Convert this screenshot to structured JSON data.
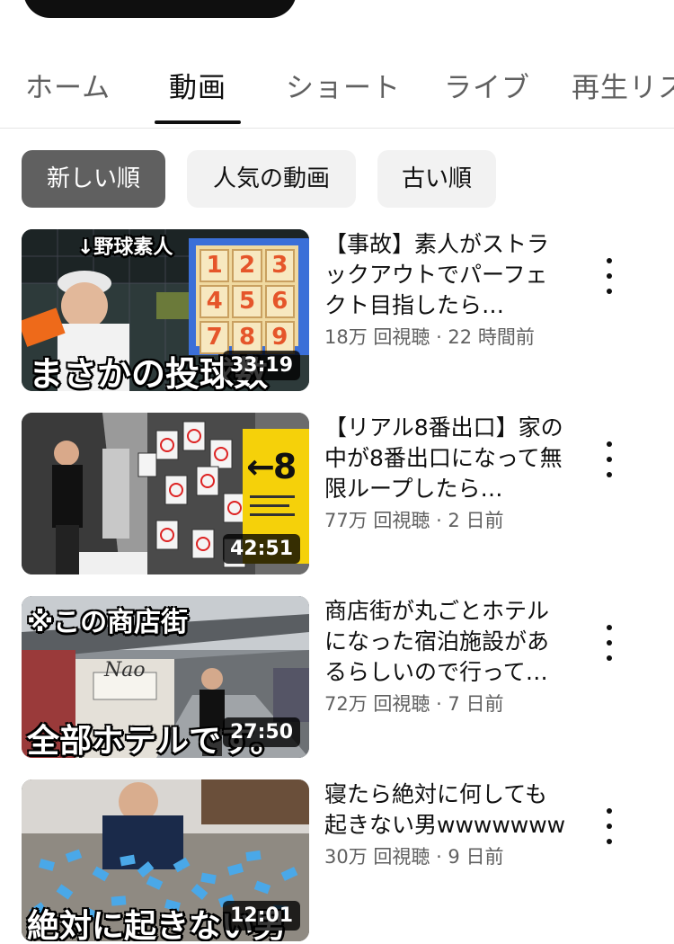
{
  "tabs": [
    {
      "label": "ホーム"
    },
    {
      "label": "動画"
    },
    {
      "label": "ショート"
    },
    {
      "label": "ライブ"
    },
    {
      "label": "再生リスト"
    }
  ],
  "active_tab": "動画",
  "chips": [
    {
      "label": "新しい順",
      "selected": true
    },
    {
      "label": "人気の動画",
      "selected": false
    },
    {
      "label": "古い順",
      "selected": false
    }
  ],
  "videos": [
    {
      "title": "【事故】素人がストラックアウトでパーフェクト目指したら…",
      "meta": "18万 回視聴 · 22 時間前",
      "duration": "33:19",
      "thumb_top_text": "↓野球素人",
      "thumb_bottom_text": "まさかの投球数",
      "thumb_numbers": [
        "1",
        "2",
        "3",
        "4",
        "5",
        "6",
        "7",
        "8",
        "9"
      ]
    },
    {
      "title": "【リアル8番出口】家の中が8番出口になって無限ループしたら…",
      "meta": "77万 回視聴 · 2 日前",
      "duration": "42:51",
      "thumb_sign": "←8"
    },
    {
      "title": "商店街が丸ごとホテルになった宿泊施設があるらしいので行ってみた",
      "meta": "72万 回視聴 · 7 日前",
      "duration": "27:50",
      "thumb_top_text": "※この商店街",
      "thumb_bottom_text": "全部ホテルです。"
    },
    {
      "title": "寝たら絶対に何しても起きない男wwwwwww",
      "meta": "30万 回視聴 · 9 日前",
      "duration": "12:01",
      "thumb_bottom_text": "絶対に起きない男"
    }
  ],
  "colors": {
    "text_primary": "#0f0f0f",
    "text_secondary": "#606060",
    "chip_bg": "#f2f2f2",
    "chip_selected_bg": "#606060"
  }
}
